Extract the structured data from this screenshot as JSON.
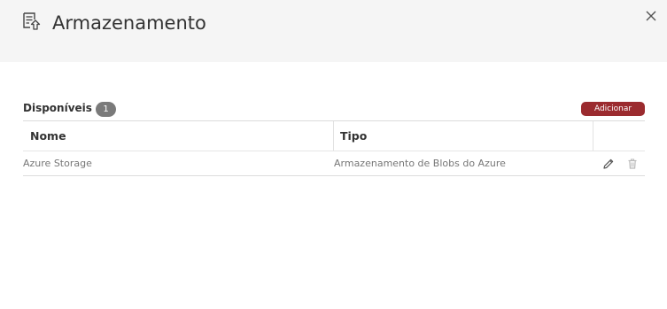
{
  "header": {
    "title": "Armazenamento",
    "icon": "storage-upload-icon",
    "close_icon": "close-icon"
  },
  "section": {
    "title": "Disponíveis",
    "count": "1",
    "add_label": "Adicionar"
  },
  "table": {
    "columns": [
      "Nome",
      "Tipo"
    ],
    "rows": [
      {
        "nome": "Azure Storage",
        "tipo": "Armazenamento de Blobs do Azure",
        "actions": [
          "edit-icon",
          "delete-icon"
        ]
      }
    ]
  },
  "colors": {
    "header_bg": "#f5f5f5",
    "accent": "#9b2b2f",
    "badge": "#7a7a7a"
  }
}
